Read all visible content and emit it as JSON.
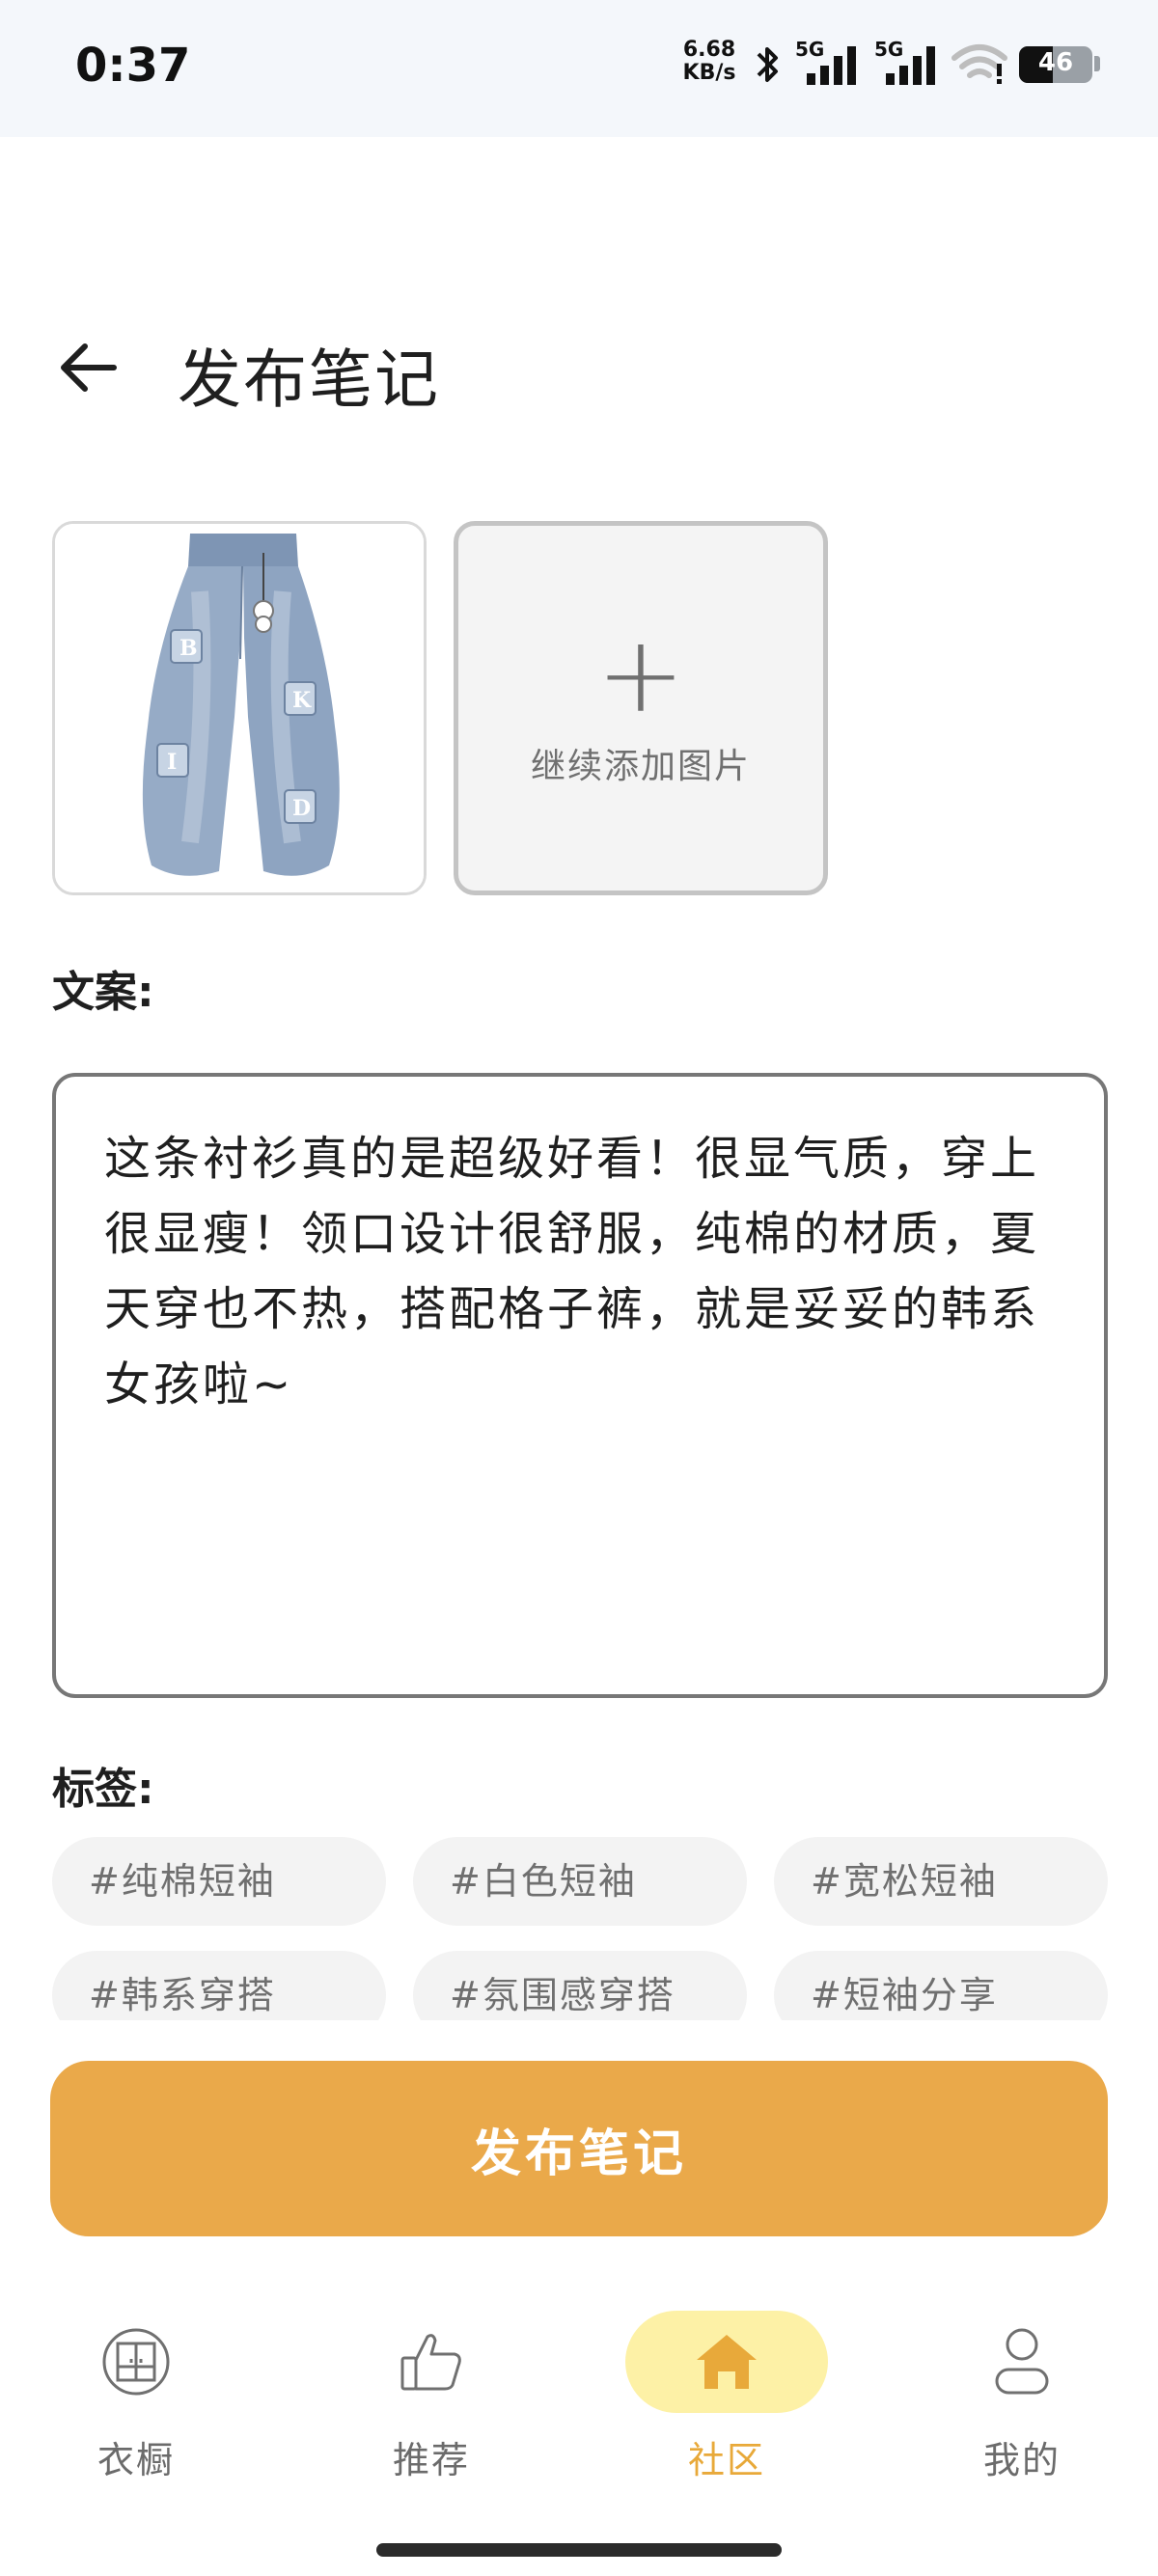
{
  "status_bar": {
    "time": "0:37",
    "net_speed_value": "6.68",
    "net_speed_unit": "KB/s",
    "sim1": "5G",
    "sim2": "5G",
    "battery": "46"
  },
  "header": {
    "title": "发布笔记"
  },
  "images": {
    "thumb_letters": [
      "B",
      "K",
      "I",
      "D"
    ],
    "add_label": "继续添加图片"
  },
  "caption": {
    "label": "文案:",
    "text": "这条衬衫真的是超级好看！很显气质，穿上很显瘦！领口设计很舒服，纯棉的材质，夏天穿也不热，搭配格子裤，就是妥妥的韩系女孩啦~"
  },
  "tags": {
    "label": "标签:",
    "items": [
      "#纯棉短袖",
      "#白色短袖",
      "#宽松短袖",
      "#韩系穿搭",
      "#氛围感穿搭",
      "#短袖分享"
    ]
  },
  "publish_button": {
    "label": "发布笔记"
  },
  "nav": [
    {
      "label": "衣橱",
      "icon": "wardrobe-icon",
      "active": false
    },
    {
      "label": "推荐",
      "icon": "thumbs-up-icon",
      "active": false
    },
    {
      "label": "社区",
      "icon": "home-icon",
      "active": true
    },
    {
      "label": "我的",
      "icon": "person-icon",
      "active": false
    }
  ],
  "colors": {
    "accent": "#EAA94A",
    "active_nav_pill": "#FDF1A6",
    "active_nav_text": "#E8A93A",
    "tag_bg": "#F3F3F3"
  }
}
